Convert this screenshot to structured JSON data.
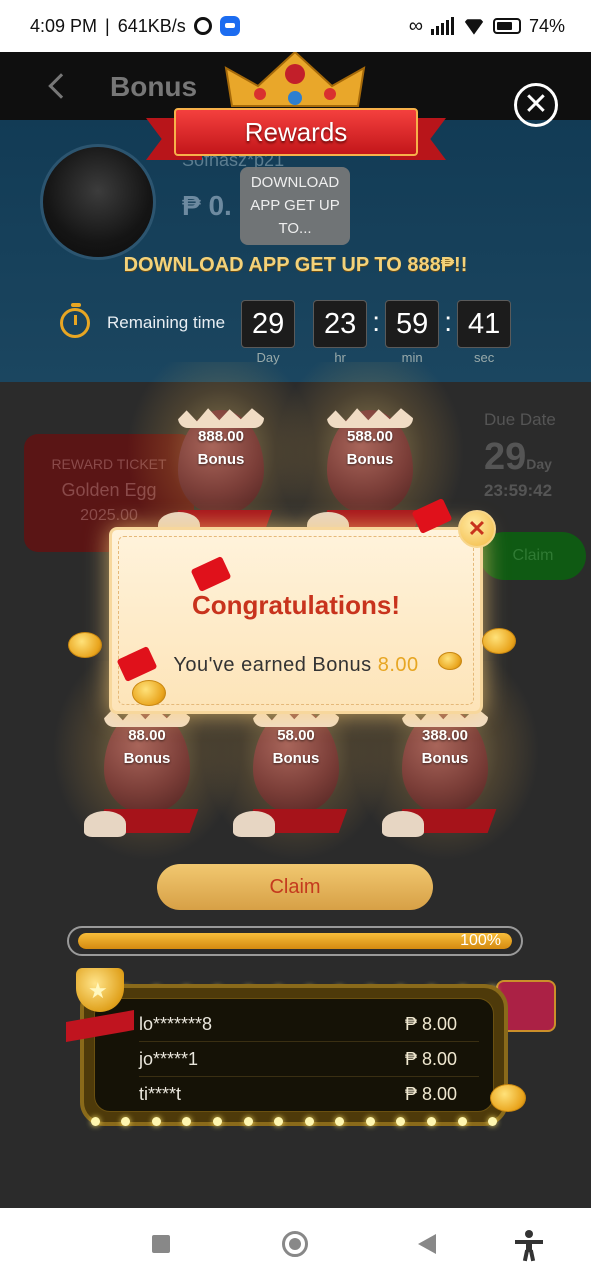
{
  "status_bar": {
    "time": "4:09 PM",
    "speed": "641KB/s",
    "battery": "74%"
  },
  "background_page": {
    "header_title": "Bonus",
    "username": "Sofnasz*p21",
    "balance": "₱ 0.",
    "ticket": {
      "label": "REWARD TICKET",
      "name": "Golden Egg",
      "amount": "2025.00"
    },
    "due_date": {
      "label": "Due Date",
      "days": "29",
      "days_unit": "Day",
      "time": "23:59:42"
    },
    "claim_label": "Claim"
  },
  "modal": {
    "banner_title": "Rewards",
    "tooltip": "DOWNLOAD APP GET UP TO...",
    "promo": "DOWNLOAD APP GET UP TO 888₱!!",
    "timer": {
      "label": "Remaining time",
      "day": "29",
      "hr": "23",
      "min": "59",
      "sec": "41",
      "units": {
        "day": "Day",
        "hr": "hr",
        "min": "min",
        "sec": "sec"
      }
    },
    "eggs": [
      {
        "amount": "888.00",
        "label": "Bonus"
      },
      {
        "amount": "588.00",
        "label": "Bonus"
      },
      {
        "amount": "88.00",
        "label": "Bonus"
      },
      {
        "amount": "58.00",
        "label": "Bonus"
      },
      {
        "amount": "388.00",
        "label": "Bonus"
      }
    ],
    "congrats": {
      "title": "Congratulations!",
      "message": "You've earned Bonus",
      "amount": "8.00"
    },
    "claim_label": "Claim",
    "progress": {
      "value": 1.0,
      "label": "100%"
    },
    "winners": [
      {
        "name": "lo*******8",
        "amount": "₱ 8.00"
      },
      {
        "name": "jo*****1",
        "amount": "₱ 8.00"
      },
      {
        "name": "ti****t",
        "amount": "₱ 8.00"
      }
    ]
  },
  "colors": {
    "accent_gold": "#e7a623",
    "ribbon_red": "#c3161a",
    "congrats_red": "#c8331d"
  }
}
